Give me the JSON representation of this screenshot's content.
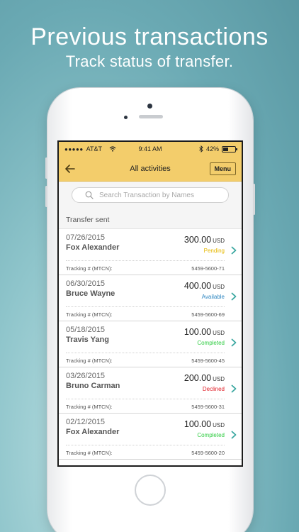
{
  "headline": "Previous transactions",
  "subhead": "Track status of transfer.",
  "status_bar": {
    "carrier": "AT&T",
    "time": "9:41 AM",
    "battery": "42%",
    "battery_level": 0.42
  },
  "nav": {
    "title": "All activities",
    "menu_label": "Menu"
  },
  "search": {
    "placeholder": "Search Transaction by Names"
  },
  "section_title": "Transfer sent",
  "tracking_label": "Tracking # (MTCN):",
  "colors": {
    "accent": "#f3cd6b",
    "pending": "#e6b800",
    "available": "#2e86c1",
    "completed": "#2ecc40",
    "declined": "#e01b24",
    "chevron": "#3aa7a0"
  },
  "transactions": [
    {
      "date": "07/26/2015",
      "name": "Fox Alexander",
      "amount": "300.00",
      "currency": "USD",
      "status": "Pending",
      "tracking": "5459-5600-71"
    },
    {
      "date": "06/30/2015",
      "name": "Bruce Wayne",
      "amount": "400.00",
      "currency": "USD",
      "status": "Available",
      "tracking": "5459-5600-69"
    },
    {
      "date": "05/18/2015",
      "name": "Travis Yang",
      "amount": "100.00",
      "currency": "USD",
      "status": "Completed",
      "tracking": "5459-5600-45"
    },
    {
      "date": "03/26/2015",
      "name": "Bruno Carman",
      "amount": "200.00",
      "currency": "USD",
      "status": "Declined",
      "tracking": "5459-5600-31"
    },
    {
      "date": "02/12/2015",
      "name": "Fox Alexander",
      "amount": "100.00",
      "currency": "USD",
      "status": "Completed",
      "tracking": "5459-5600-20"
    }
  ]
}
